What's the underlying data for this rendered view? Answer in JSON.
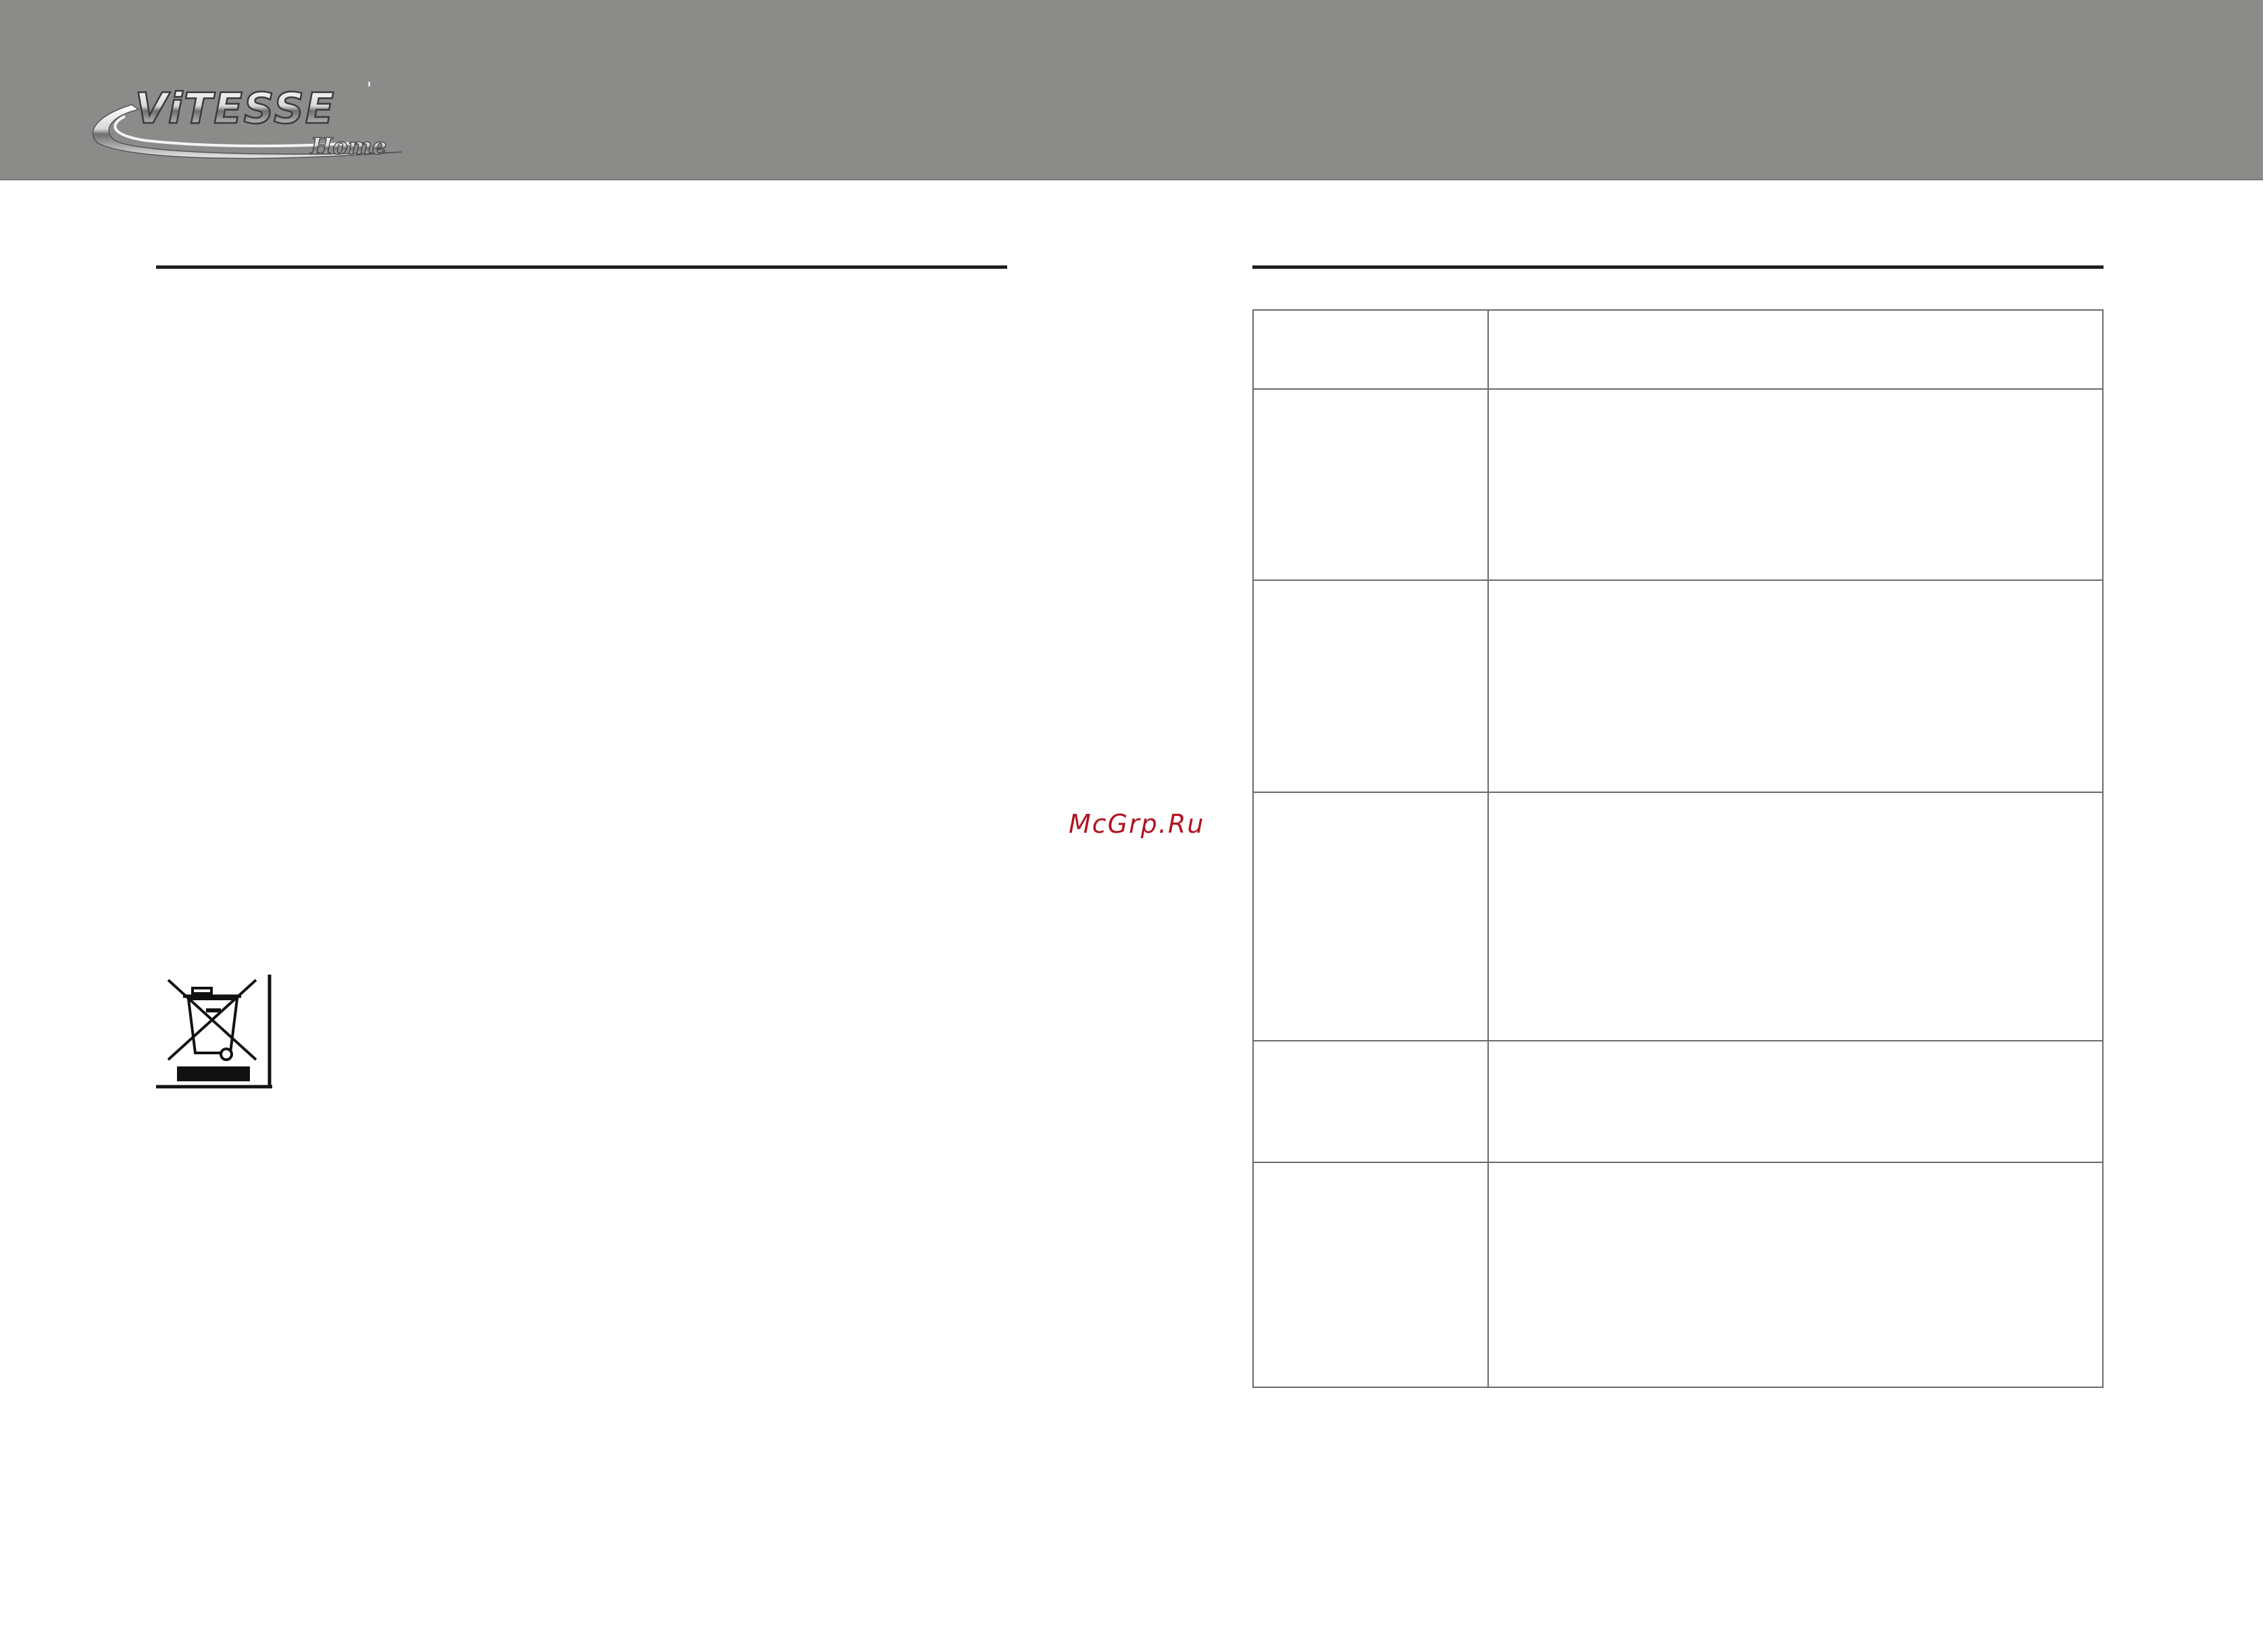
{
  "brand": {
    "logo_text": "ViTESSE",
    "logo_subtext": "Home"
  },
  "watermark": "McGrp.Ru",
  "icons": {
    "recycling": "crossed-out-wheelie-bin-icon"
  },
  "colors": {
    "header_bg": "#8b8c8a",
    "watermark": "#b01622",
    "rule": "#1e1e1e"
  },
  "table": {
    "rows": [
      {
        "label": "",
        "text": ""
      },
      {
        "label": "",
        "text": ""
      },
      {
        "label": "",
        "text": ""
      },
      {
        "label": "",
        "text": ""
      },
      {
        "label": "",
        "text": ""
      },
      {
        "label": "",
        "text": ""
      }
    ]
  }
}
